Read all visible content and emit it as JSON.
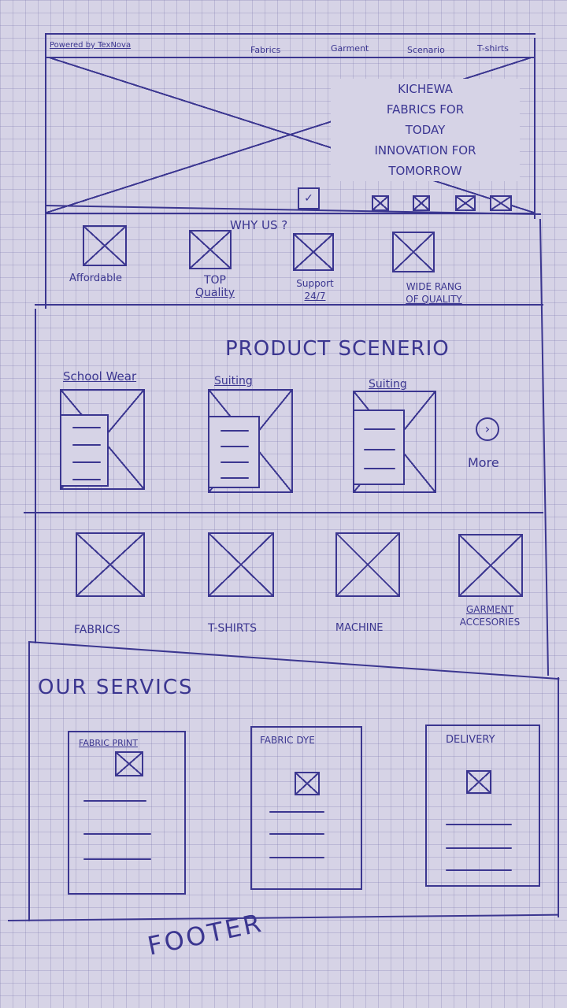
{
  "nav": {
    "brand": "Powered by TexNova",
    "items": [
      {
        "label": "Fabrics"
      },
      {
        "label": "Garment"
      },
      {
        "label": "Scenario"
      },
      {
        "label": "T-shirts"
      }
    ]
  },
  "hero": {
    "tagline_lines": [
      "KICHEWA",
      "FABRICS FOR",
      "TODAY",
      "INNOVATION FOR",
      "TOMORROW"
    ]
  },
  "why_us": {
    "title": "WHY US ?",
    "items": [
      {
        "label": "Affordable"
      },
      {
        "label_lines": [
          "TOP",
          "Quality"
        ]
      },
      {
        "label_lines": [
          "Support",
          "24/7"
        ]
      },
      {
        "label_lines": [
          "WIDE RANG",
          "OF QUALITY"
        ]
      }
    ]
  },
  "products": {
    "title": "PRODUCT SCENERIO",
    "items": [
      {
        "label": "School Wear"
      },
      {
        "label": "Suiting"
      },
      {
        "label": "Suiting"
      }
    ],
    "more_label": "More"
  },
  "categories": {
    "items": [
      {
        "label": "FABRICS"
      },
      {
        "label": "T-SHIRTS"
      },
      {
        "label": "MACHINE"
      },
      {
        "label_lines": [
          "GARMENT",
          "ACCESORIES"
        ]
      }
    ]
  },
  "services": {
    "title": "OUR SERVICS",
    "items": [
      {
        "label": "FABRIC PRINT"
      },
      {
        "label": "FABRIC DYE"
      },
      {
        "label": "DELIVERY"
      }
    ]
  },
  "footer": {
    "label": "FOOTER"
  }
}
